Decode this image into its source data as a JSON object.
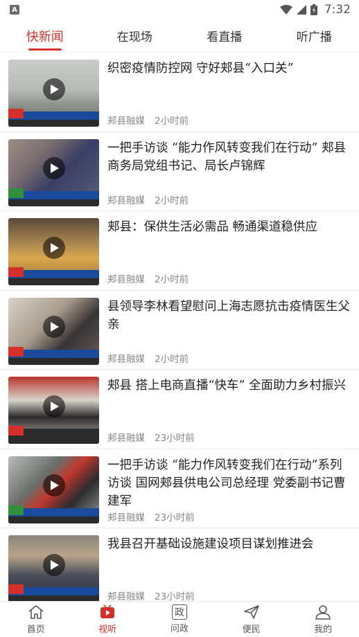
{
  "status_bar": {
    "left_badge": "A",
    "time": "7:32"
  },
  "top_tabs": [
    {
      "label": "快新闻",
      "active": true
    },
    {
      "label": "在现场",
      "active": false
    },
    {
      "label": "看直播",
      "active": false
    },
    {
      "label": "听广播",
      "active": false
    }
  ],
  "news": [
    {
      "title": "织密疫情防控网 守好郏县“入口关”",
      "source": "郏县融媒",
      "time": "2小时前"
    },
    {
      "title": "一把手访谈 “能力作风转变我们在行动” 郏县商务局党组书记、局长卢锦辉",
      "source": "郏县融媒",
      "time": "2小时前"
    },
    {
      "title": "郏县：保供生活必需品 畅通渠道稳供应",
      "source": "郏县融媒",
      "time": "2小时前"
    },
    {
      "title": "县领导李林看望慰问上海志愿抗击疫情医生父亲",
      "source": "郏县融媒",
      "time": "2小时前"
    },
    {
      "title": " 郏县 搭上电商直播“快车” 全面助力乡村振兴",
      "source": "郏县融媒",
      "time": "23小时前"
    },
    {
      "title": "一把手访谈 “能力作风转变我们在行动”系列访谈 国网郏县供电公司总经理 党委副书记曹建军",
      "source": "郏县融媒",
      "time": "23小时前"
    },
    {
      "title": "我县召开基础设施建设项目谋划推进会",
      "source": "郏县融媒",
      "time": "23小时前"
    }
  ],
  "bottom_nav": [
    {
      "label": "首页",
      "icon": "home-icon",
      "active": false
    },
    {
      "label": "视听",
      "icon": "video-icon",
      "active": true
    },
    {
      "label": "问政",
      "icon": "zheng-icon",
      "glyph": "政",
      "active": false
    },
    {
      "label": "便民",
      "icon": "send-icon",
      "active": false
    },
    {
      "label": "我的",
      "icon": "user-icon",
      "active": false
    }
  ],
  "colors": {
    "accent": "#d4302a",
    "text": "#222222",
    "meta": "#888888"
  }
}
